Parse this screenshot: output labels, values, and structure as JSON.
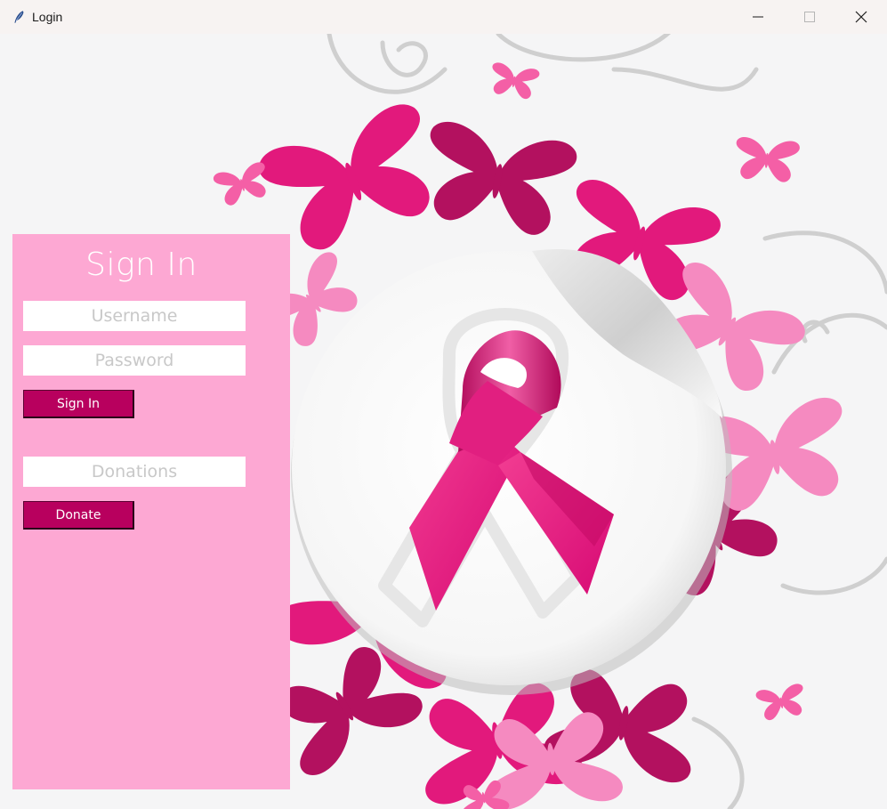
{
  "window": {
    "title": "Login",
    "app_icon": "feather-icon",
    "controls": [
      "minimize-icon",
      "maximize-icon",
      "close-icon"
    ]
  },
  "signin": {
    "title": "Sign In",
    "username_placeholder": "Username",
    "username_value": "",
    "password_placeholder": "Password",
    "password_value": "",
    "signin_button": "Sign In",
    "donations_placeholder": "Donations",
    "donations_value": "",
    "donate_button": "Donate"
  },
  "background": {
    "image": "pink-ribbon-sticker-with-butterflies",
    "colors": {
      "panel": "#fda8d3",
      "button": "#b8005e",
      "primary_pink": "#e2197c",
      "magenta": "#b3115f",
      "light_pink": "#f58ac0"
    }
  }
}
